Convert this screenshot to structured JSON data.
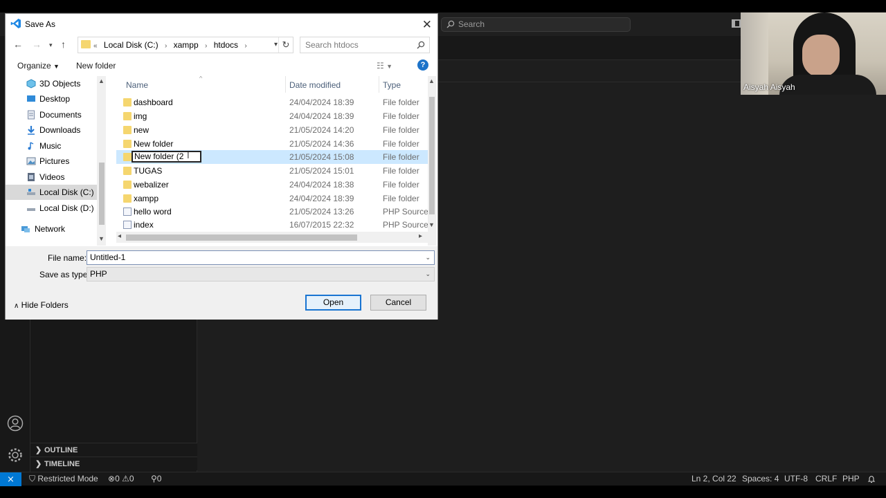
{
  "vscode": {
    "search_placeholder": "Search",
    "sections": [
      "OUTLINE",
      "TIMELINE"
    ],
    "status": {
      "restricted": "Restricted Mode",
      "errors": "0",
      "warnings": "0",
      "ports": "0",
      "position": "Ln 2, Col 22",
      "spaces": "Spaces: 4",
      "encoding": "UTF-8",
      "eol": "CRLF",
      "language": "PHP"
    },
    "accent_color": "#0078d4"
  },
  "dialog": {
    "title": "Save As",
    "address": [
      "Local Disk (C:)",
      "xampp",
      "htdocs"
    ],
    "address_prefix": "«",
    "search_placeholder": "Search htdocs",
    "toolbar": {
      "organize": "Organize",
      "new_folder": "New folder",
      "help": "?"
    },
    "nav_items": [
      {
        "label": "3D Objects",
        "icon": "3d-objects-icon"
      },
      {
        "label": "Desktop",
        "icon": "desktop-icon"
      },
      {
        "label": "Documents",
        "icon": "documents-icon"
      },
      {
        "label": "Downloads",
        "icon": "downloads-icon"
      },
      {
        "label": "Music",
        "icon": "music-icon"
      },
      {
        "label": "Pictures",
        "icon": "pictures-icon"
      },
      {
        "label": "Videos",
        "icon": "videos-icon"
      },
      {
        "label": "Local Disk (C:)",
        "icon": "drive-icon"
      },
      {
        "label": "Local Disk (D:)",
        "icon": "drive-icon"
      },
      {
        "label": "Network",
        "icon": "network-icon"
      }
    ],
    "columns": {
      "name": "Name",
      "date": "Date modified",
      "type": "Type"
    },
    "files": [
      {
        "name": "dashboard",
        "date": "24/04/2024 18:39",
        "type": "File folder",
        "kind": "folder"
      },
      {
        "name": "img",
        "date": "24/04/2024 18:39",
        "type": "File folder",
        "kind": "folder"
      },
      {
        "name": "new",
        "date": "21/05/2024 14:20",
        "type": "File folder",
        "kind": "folder"
      },
      {
        "name": "New folder",
        "date": "21/05/2024 14:36",
        "type": "File folder",
        "kind": "folder"
      },
      {
        "name": "New folder (2",
        "date": "21/05/2024 15:08",
        "type": "File folder",
        "kind": "folder",
        "editing": true
      },
      {
        "name": "TUGAS",
        "date": "21/05/2024 15:01",
        "type": "File folder",
        "kind": "folder"
      },
      {
        "name": "webalizer",
        "date": "24/04/2024 18:38",
        "type": "File folder",
        "kind": "folder"
      },
      {
        "name": "xampp",
        "date": "24/04/2024 18:39",
        "type": "File folder",
        "kind": "folder"
      },
      {
        "name": "hello word",
        "date": "21/05/2024 13:26",
        "type": "PHP Source File",
        "kind": "file"
      },
      {
        "name": "index",
        "date": "16/07/2015 22:32",
        "type": "PHP Source File",
        "kind": "file"
      }
    ],
    "file_name_label": "File name:",
    "file_name_value": "Untitled-1",
    "save_type_label": "Save as type:",
    "save_type_value": "PHP",
    "hide_folders": "Hide Folders",
    "open_label": "Open",
    "cancel_label": "Cancel"
  },
  "webcam": {
    "name": "Aisyah Aisyah"
  }
}
